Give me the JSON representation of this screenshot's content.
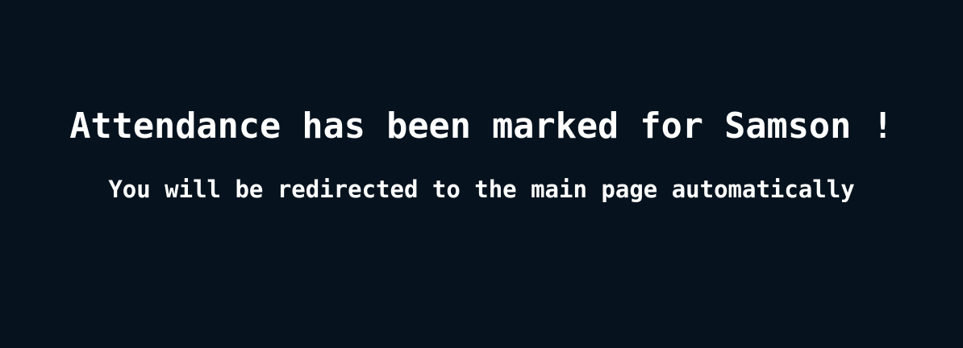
{
  "message": {
    "title": "Attendance has been marked for Samson !",
    "subtitle": "You will be redirected to the main page automatically"
  },
  "colors": {
    "background": "#06131f",
    "text": "#ffffff"
  }
}
